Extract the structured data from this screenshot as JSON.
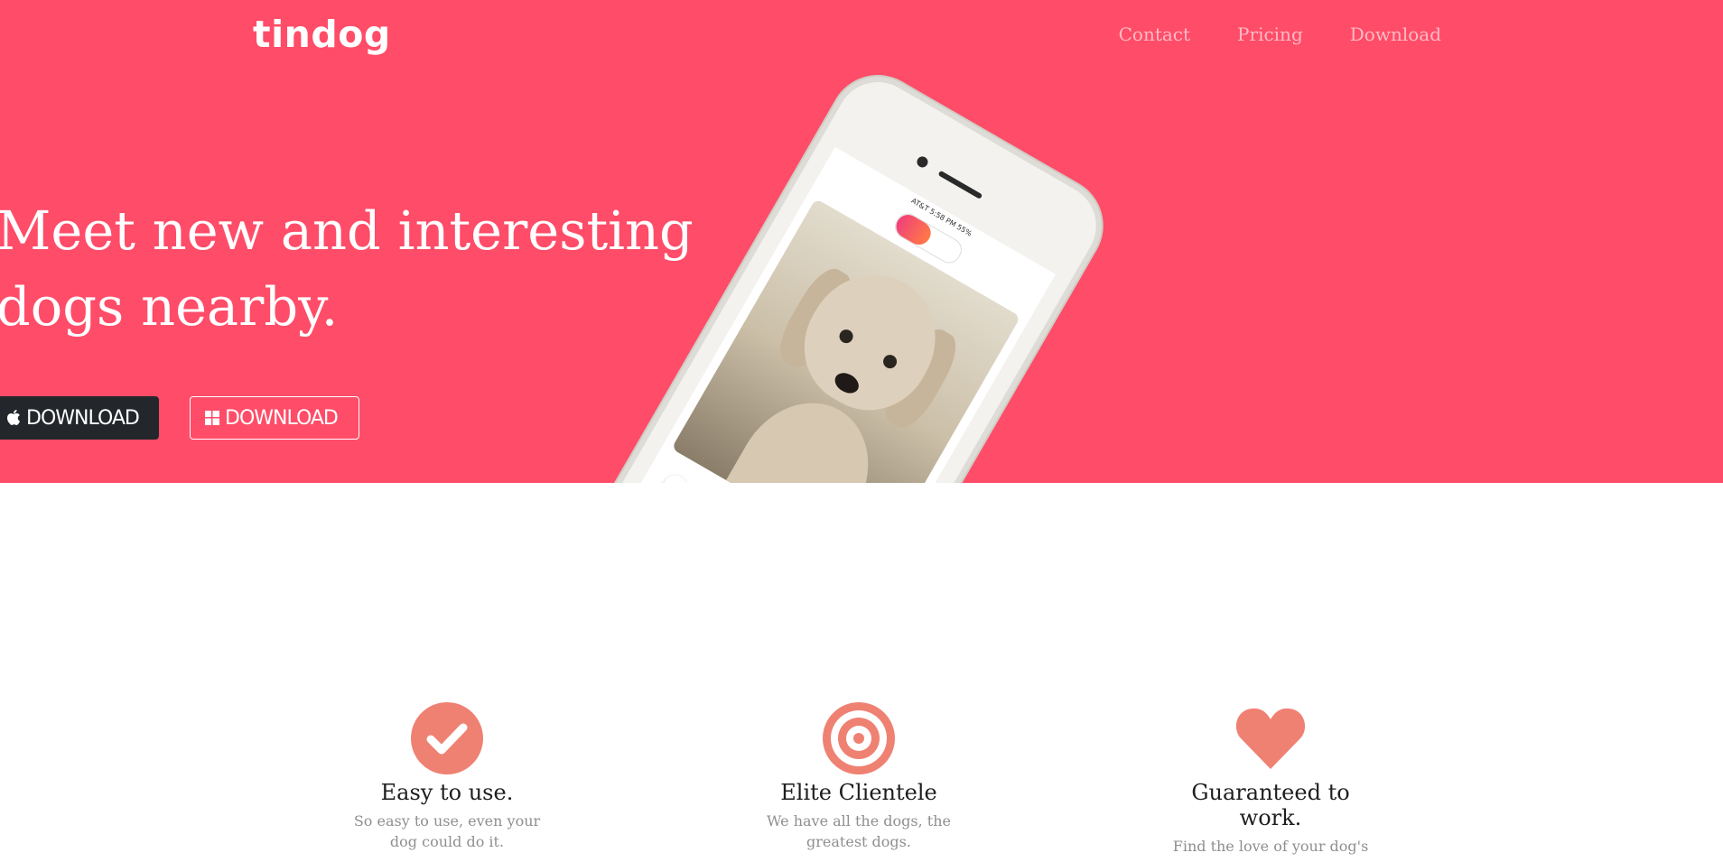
{
  "brand": {
    "name": "tindog"
  },
  "nav": {
    "items": [
      {
        "label": "Contact"
      },
      {
        "label": "Pricing"
      },
      {
        "label": "Download"
      }
    ]
  },
  "hero": {
    "headline": "Meet new and interesting dogs nearby.",
    "buttons": [
      {
        "label": "DOWNLOAD",
        "icon": "apple-icon"
      },
      {
        "label": "DOWNLOAD",
        "icon": "windows-icon"
      }
    ],
    "background_color": "#ff4c68"
  },
  "phone": {
    "status": "AT&T      5:58 PM      55%"
  },
  "features": [
    {
      "icon": "check-circle-icon",
      "title": "Easy to use.",
      "text": "So easy to use, even your dog could do it."
    },
    {
      "icon": "bullseye-icon",
      "title": "Elite Clientele",
      "text": "We have all the dogs, the greatest dogs."
    },
    {
      "icon": "heart-icon",
      "title": "Guaranteed to work.",
      "text": "Find the love of your dog's"
    }
  ],
  "colors": {
    "accent": "#ef8172",
    "hero_bg": "#ff4c68",
    "dark_button": "#23272b"
  }
}
